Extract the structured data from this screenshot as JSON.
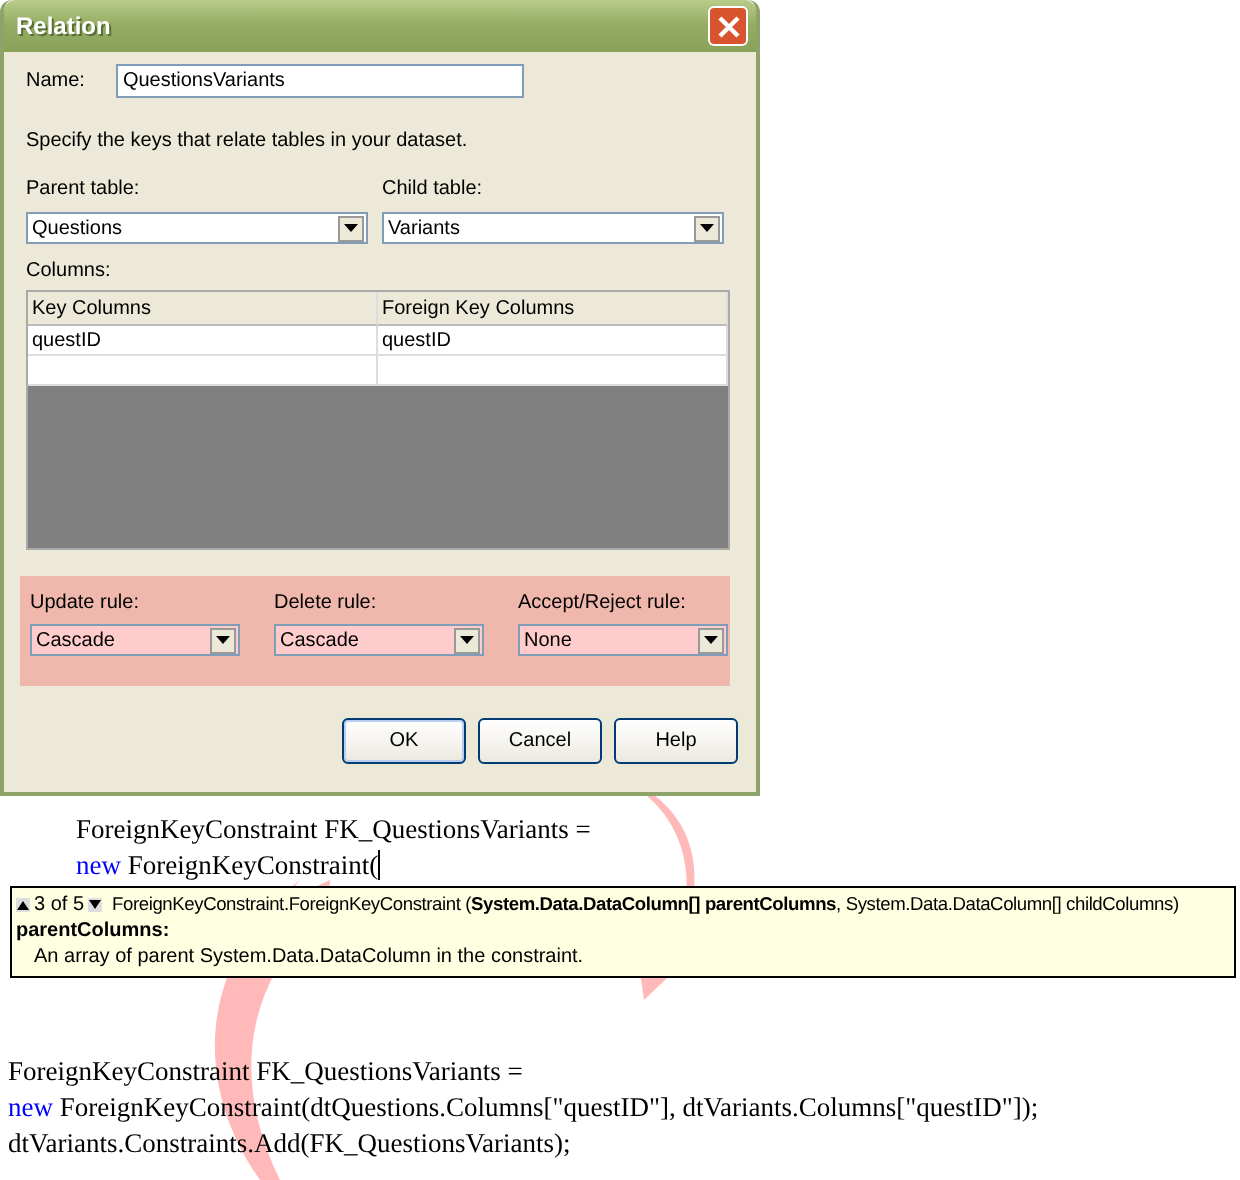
{
  "window": {
    "title": "Relation"
  },
  "name_field": {
    "label": "Name:",
    "value": "QuestionsVariants"
  },
  "instruction": "Specify the keys that relate tables in your dataset.",
  "tables": [
    {
      "label": "Parent table:",
      "value": "Questions"
    },
    {
      "label": "Child table:",
      "value": "Variants"
    }
  ],
  "columns": {
    "label": "Columns:",
    "headers": [
      "Key Columns",
      "Foreign Key Columns"
    ],
    "rows": [
      [
        "questID",
        "questID"
      ]
    ]
  },
  "rules": [
    {
      "label": "Update rule:",
      "value": "Cascade"
    },
    {
      "label": "Delete rule:",
      "value": "Cascade"
    },
    {
      "label": "Accept/Reject rule:",
      "value": "None"
    }
  ],
  "buttons": [
    "OK",
    "Cancel",
    "Help"
  ],
  "code_top": [
    [
      {
        "kind": "plain",
        "text": "ForeignKeyConstraint FK_QuestionsVariants  ="
      }
    ],
    [
      {
        "kind": "keyword",
        "text": "new"
      },
      {
        "kind": "plain",
        "text": " ForeignKeyConstraint("
      }
    ]
  ],
  "tooltip": {
    "counter": "3 of 5",
    "signature": "ForeignKeyConstraint.ForeignKeyConstraint (**System.Data.DataColumn[] parentColumns**, System.Data.DataColumn[] childColumns)",
    "parameter": "parentColumns:",
    "description": "An array of parent System.Data.DataColumn in the constraint."
  },
  "code_bottom": [
    [
      {
        "kind": "plain",
        "text": "ForeignKeyConstraint FK_QuestionsVariants  ="
      }
    ],
    [
      {
        "kind": "keyword",
        "text": "new"
      },
      {
        "kind": "plain",
        "text": " ForeignKeyConstraint(dtQuestions.Columns[\"questID\"], dtVariants.Columns[\"questID\"]);"
      }
    ],
    [
      {
        "kind": "plain",
        "text": "dtVariants.Constraints.Add(FK_QuestionsVariants);"
      }
    ]
  ]
}
